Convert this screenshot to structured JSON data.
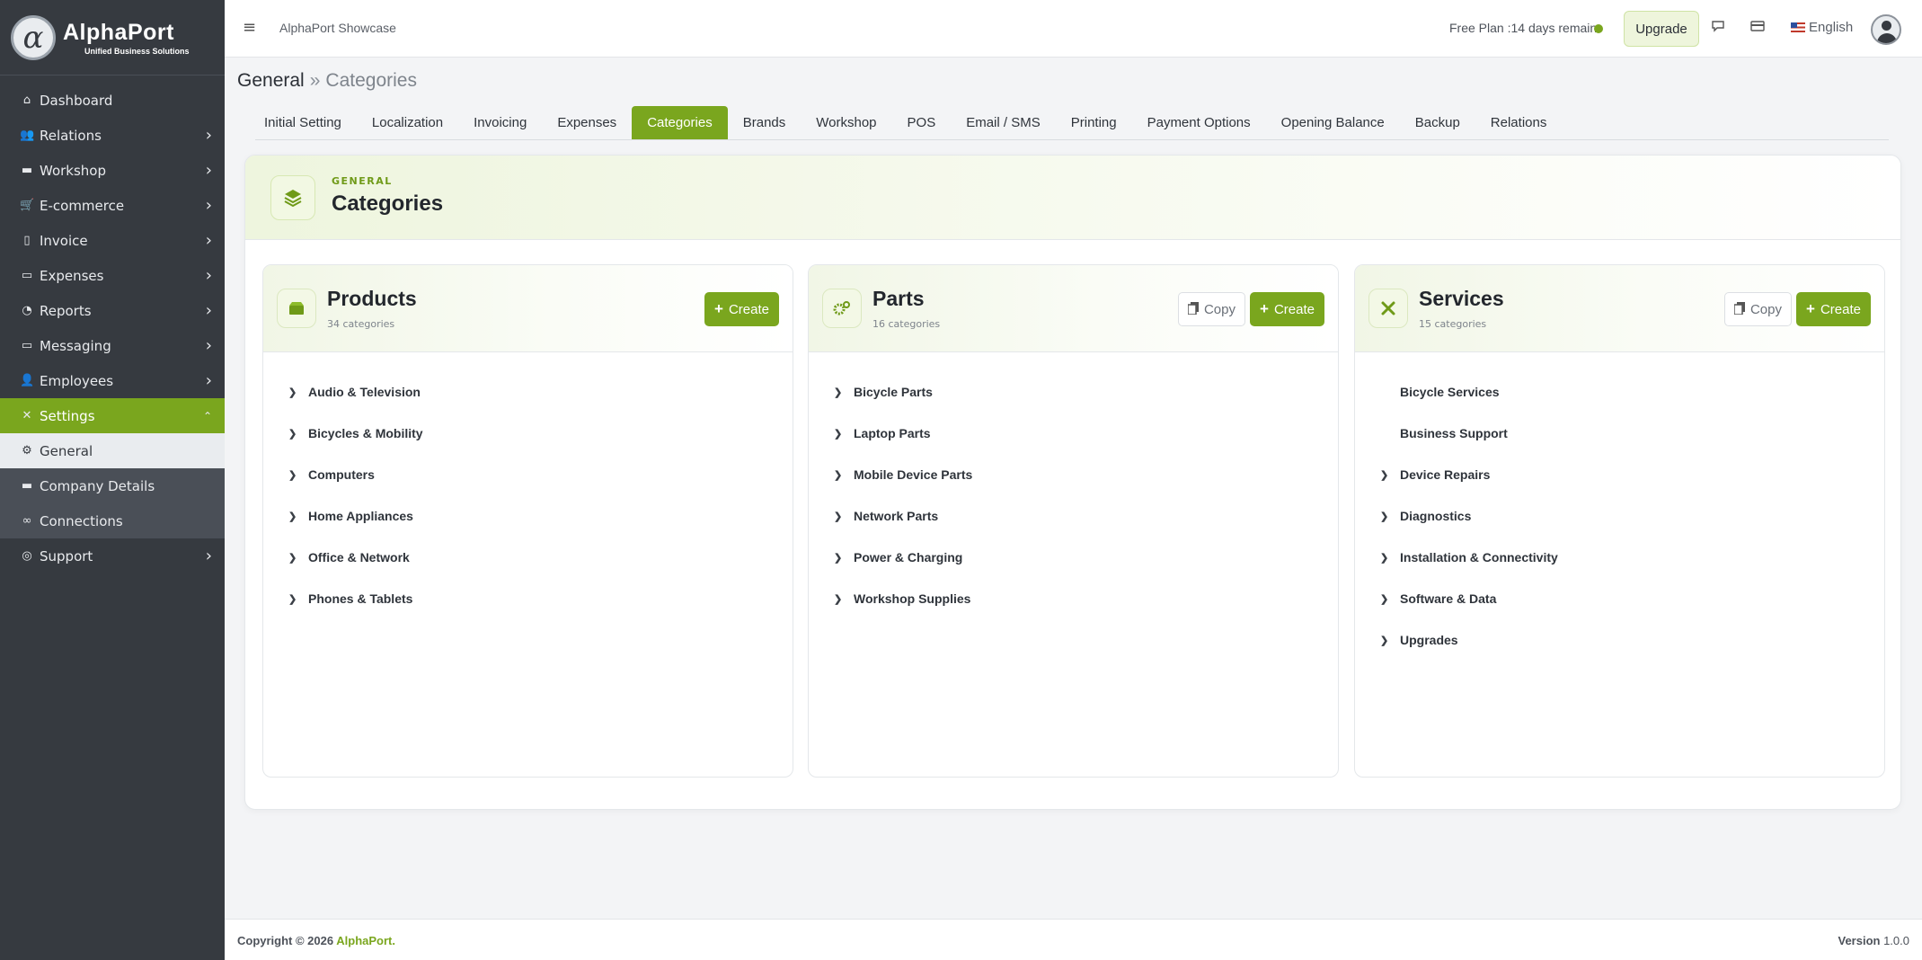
{
  "brand": {
    "name": "AlphaPort",
    "tagline": "Unified Business Solutions",
    "logo_letter": "α"
  },
  "sidebar": {
    "items": [
      {
        "label": "Dashboard",
        "icon": "home-icon",
        "has_children": false
      },
      {
        "label": "Relations",
        "icon": "users-icon",
        "has_children": true
      },
      {
        "label": "Workshop",
        "icon": "briefcase-icon",
        "has_children": true
      },
      {
        "label": "E-commerce",
        "icon": "cart-icon",
        "has_children": true
      },
      {
        "label": "Invoice",
        "icon": "document-icon",
        "has_children": true
      },
      {
        "label": "Expenses",
        "icon": "money-icon",
        "has_children": true
      },
      {
        "label": "Reports",
        "icon": "pie-chart-icon",
        "has_children": true
      },
      {
        "label": "Messaging",
        "icon": "message-icon",
        "has_children": true
      },
      {
        "label": "Employees",
        "icon": "employees-icon",
        "has_children": true
      },
      {
        "label": "Settings",
        "icon": "tools-icon",
        "has_children": true,
        "expanded": true
      },
      {
        "label": "General",
        "icon": "gear-icon",
        "sub": true,
        "current": true
      },
      {
        "label": "Company Details",
        "icon": "building-icon",
        "sub": true
      },
      {
        "label": "Connections",
        "icon": "link-icon",
        "sub": true
      },
      {
        "label": "Support",
        "icon": "lifebuoy-icon",
        "has_children": true
      }
    ]
  },
  "topbar": {
    "app_name": "AlphaPort Showcase",
    "plan_text": "Free Plan :14 days remain",
    "upgrade_label": "Upgrade",
    "language": "English"
  },
  "breadcrumb": {
    "section": "General",
    "separator": "»",
    "page": "Categories"
  },
  "tabs": [
    {
      "label": "Initial Setting"
    },
    {
      "label": "Localization"
    },
    {
      "label": "Invoicing"
    },
    {
      "label": "Expenses"
    },
    {
      "label": "Categories",
      "active": true
    },
    {
      "label": "Brands"
    },
    {
      "label": "Workshop"
    },
    {
      "label": "POS"
    },
    {
      "label": "Email / SMS"
    },
    {
      "label": "Printing"
    },
    {
      "label": "Payment Options"
    },
    {
      "label": "Opening Balance"
    },
    {
      "label": "Backup"
    },
    {
      "label": "Relations"
    }
  ],
  "card": {
    "kicker": "GENERAL",
    "title": "Categories"
  },
  "panels": [
    {
      "title": "Products",
      "count": "34 categories",
      "icon": "box-icon",
      "copy_label": null,
      "create_label": "Create",
      "items": [
        {
          "label": "Audio & Television",
          "expandable": true
        },
        {
          "label": "Bicycles & Mobility",
          "expandable": true
        },
        {
          "label": "Computers",
          "expandable": true
        },
        {
          "label": "Home Appliances",
          "expandable": true
        },
        {
          "label": "Office & Network",
          "expandable": true
        },
        {
          "label": "Phones & Tablets",
          "expandable": true
        }
      ]
    },
    {
      "title": "Parts",
      "count": "16 categories",
      "icon": "cogs-icon",
      "copy_label": "Copy",
      "create_label": "Create",
      "items": [
        {
          "label": "Bicycle Parts",
          "expandable": true
        },
        {
          "label": "Laptop Parts",
          "expandable": true
        },
        {
          "label": "Mobile Device Parts",
          "expandable": true
        },
        {
          "label": "Network Parts",
          "expandable": true
        },
        {
          "label": "Power & Charging",
          "expandable": true
        },
        {
          "label": "Workshop Supplies",
          "expandable": true
        }
      ]
    },
    {
      "title": "Services",
      "count": "15 categories",
      "icon": "tools-icon",
      "copy_label": "Copy",
      "create_label": "Create",
      "items": [
        {
          "label": "Bicycle Services",
          "expandable": false
        },
        {
          "label": "Business Support",
          "expandable": false
        },
        {
          "label": "Device Repairs",
          "expandable": true
        },
        {
          "label": "Diagnostics",
          "expandable": true
        },
        {
          "label": "Installation & Connectivity",
          "expandable": true
        },
        {
          "label": "Software & Data",
          "expandable": true
        },
        {
          "label": "Upgrades",
          "expandable": true
        }
      ]
    }
  ],
  "footer": {
    "copyright_prefix": "Copyright © 2026",
    "copyright_brand": "AlphaPort.",
    "version_label": "Version",
    "version_value": "1.0.0"
  },
  "colors": {
    "accent": "#7aa61e",
    "sidebar_bg": "#363a40",
    "page_bg": "#f3f4f6"
  }
}
